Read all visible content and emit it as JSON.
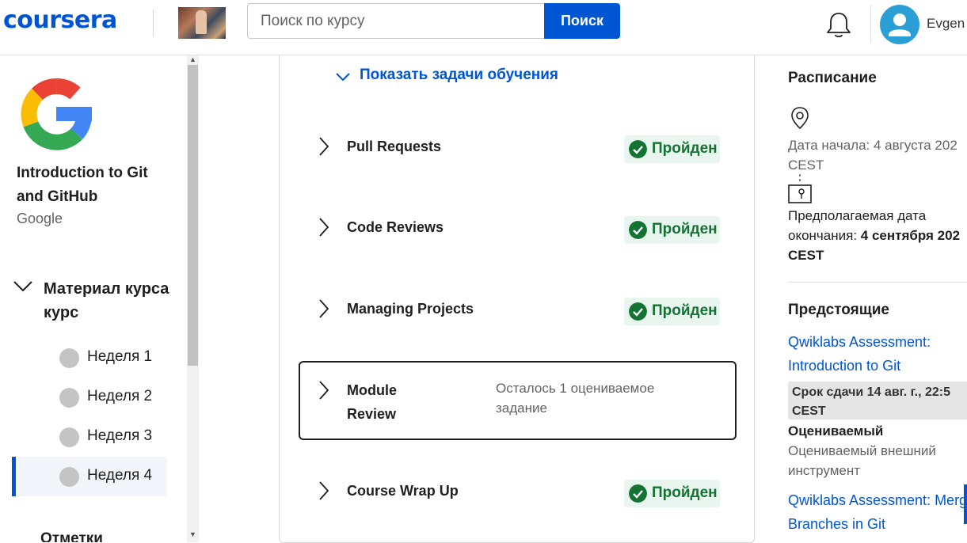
{
  "header": {
    "logo": "coursera",
    "search_placeholder": "Поиск по курсу",
    "search_button": "Поиск",
    "user_name": "Evgen"
  },
  "sidebar": {
    "course_title": "Introduction to Git and GitHub",
    "org": "Google",
    "section_label": "Материал курса курс",
    "weeks": [
      {
        "label": "Неделя 1",
        "active": false
      },
      {
        "label": "Неделя 2",
        "active": false
      },
      {
        "label": "Неделя 3",
        "active": false
      },
      {
        "label": "Неделя 4",
        "active": true
      }
    ],
    "marks_label": "Отметки"
  },
  "main": {
    "show_goals": "Показать задачи обучения",
    "lessons": [
      {
        "title": "Pull Requests",
        "status": "Пройден"
      },
      {
        "title": "Code Reviews",
        "status": "Пройден"
      },
      {
        "title": "Managing Projects",
        "status": "Пройден"
      },
      {
        "title": "Module Review",
        "note": "Осталось 1 оцениваемое задание"
      },
      {
        "title": "Course Wrap Up",
        "status": "Пройден"
      }
    ]
  },
  "right": {
    "schedule_heading": "Расписание",
    "start_line1": "Дата начала: 4 августа 202",
    "start_line2": "CEST",
    "end_line1": "Предполагаемая дата",
    "end_line2_prefix": "окончания: ",
    "end_line2_bold": "4 сентября 202",
    "end_line3": "CEST",
    "upcoming_heading": "Предстоящие",
    "item1_line1": "Qwiklabs Assessment:",
    "item1_line2": "Introduction to Git",
    "item1_due_line1": "Срок сдачи 14 авг. г., 22:5",
    "item1_due_line2": "CEST",
    "item1_type": "Оцениваемый",
    "item1_desc_line1": "Оцениваемый внешний",
    "item1_desc_line2": "инструмент",
    "item2_line1": "Qwiklabs Assessment: Merg",
    "item2_line2": "Branches in Git"
  },
  "colors": {
    "brand": "#0056d2",
    "success": "#137333",
    "success_bg": "#e9f5ef"
  }
}
